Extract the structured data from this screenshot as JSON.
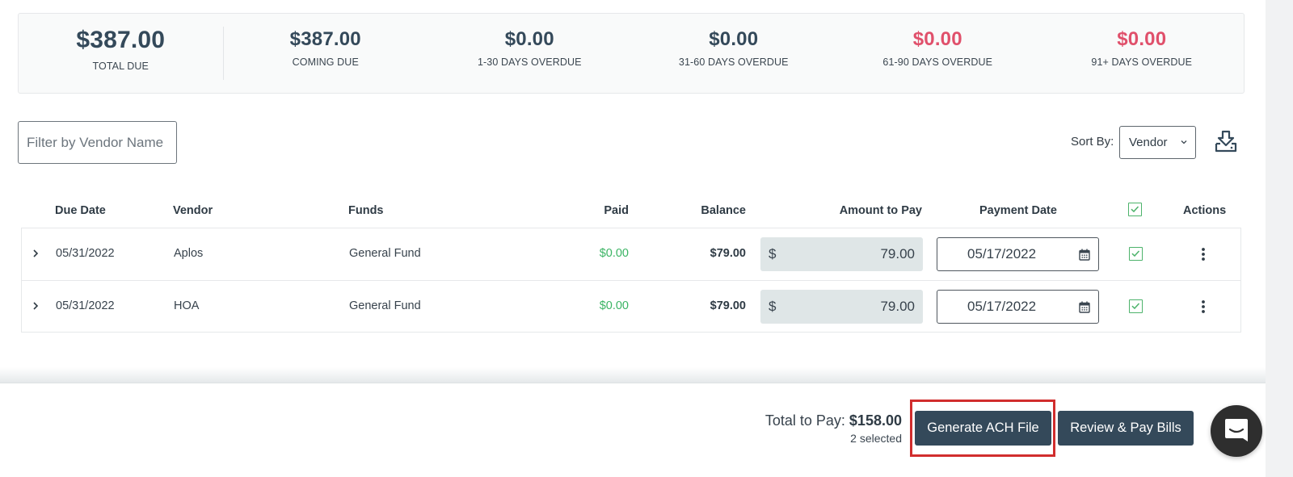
{
  "summary": {
    "items": [
      {
        "amount": "$387.00",
        "label": "TOTAL DUE",
        "color": "#34495a"
      },
      {
        "amount": "$387.00",
        "label": "COMING DUE",
        "color": "#34495a"
      },
      {
        "amount": "$0.00",
        "label": "1-30 DAYS OVERDUE",
        "color": "#34495a"
      },
      {
        "amount": "$0.00",
        "label": "31-60 DAYS OVERDUE",
        "color": "#34495a"
      },
      {
        "amount": "$0.00",
        "label": "61-90 DAYS OVERDUE",
        "color": "#e0506b"
      },
      {
        "amount": "$0.00",
        "label": "91+ DAYS OVERDUE",
        "color": "#e0506b"
      }
    ]
  },
  "toolbar": {
    "filter_placeholder": "Filter by Vendor Name",
    "filter_value": "",
    "sort_label": "Sort By:",
    "sort_selected": "Vendor",
    "download_icon": "download-tray-icon"
  },
  "table": {
    "columns": {
      "due_date": "Due Date",
      "vendor": "Vendor",
      "funds": "Funds",
      "paid": "Paid",
      "balance": "Balance",
      "amount_to_pay": "Amount to Pay",
      "payment_date": "Payment Date",
      "select_all_checked": true,
      "actions": "Actions"
    },
    "rows": [
      {
        "due_date": "05/31/2022",
        "vendor": "Aplos",
        "funds": "General Fund",
        "paid": "$0.00",
        "balance": "$79.00",
        "currency_symbol": "$",
        "amount_to_pay": "79.00",
        "payment_date": "05/17/2022",
        "selected": true
      },
      {
        "due_date": "05/31/2022",
        "vendor": "HOA",
        "funds": "General Fund",
        "paid": "$0.00",
        "balance": "$79.00",
        "currency_symbol": "$",
        "amount_to_pay": "79.00",
        "payment_date": "05/17/2022",
        "selected": true
      }
    ]
  },
  "footer": {
    "total_label": "Total to Pay:",
    "total_amount": "$158.00",
    "selected_count": "2 selected",
    "generate_ach_label": "Generate ACH File",
    "review_pay_label": "Review & Pay Bills"
  },
  "colors": {
    "primary": "#34495a",
    "overdue": "#e0506b",
    "paid_green": "#3bb464",
    "checkbox_green": "#4db36b",
    "highlight_red": "#d12d2d"
  }
}
